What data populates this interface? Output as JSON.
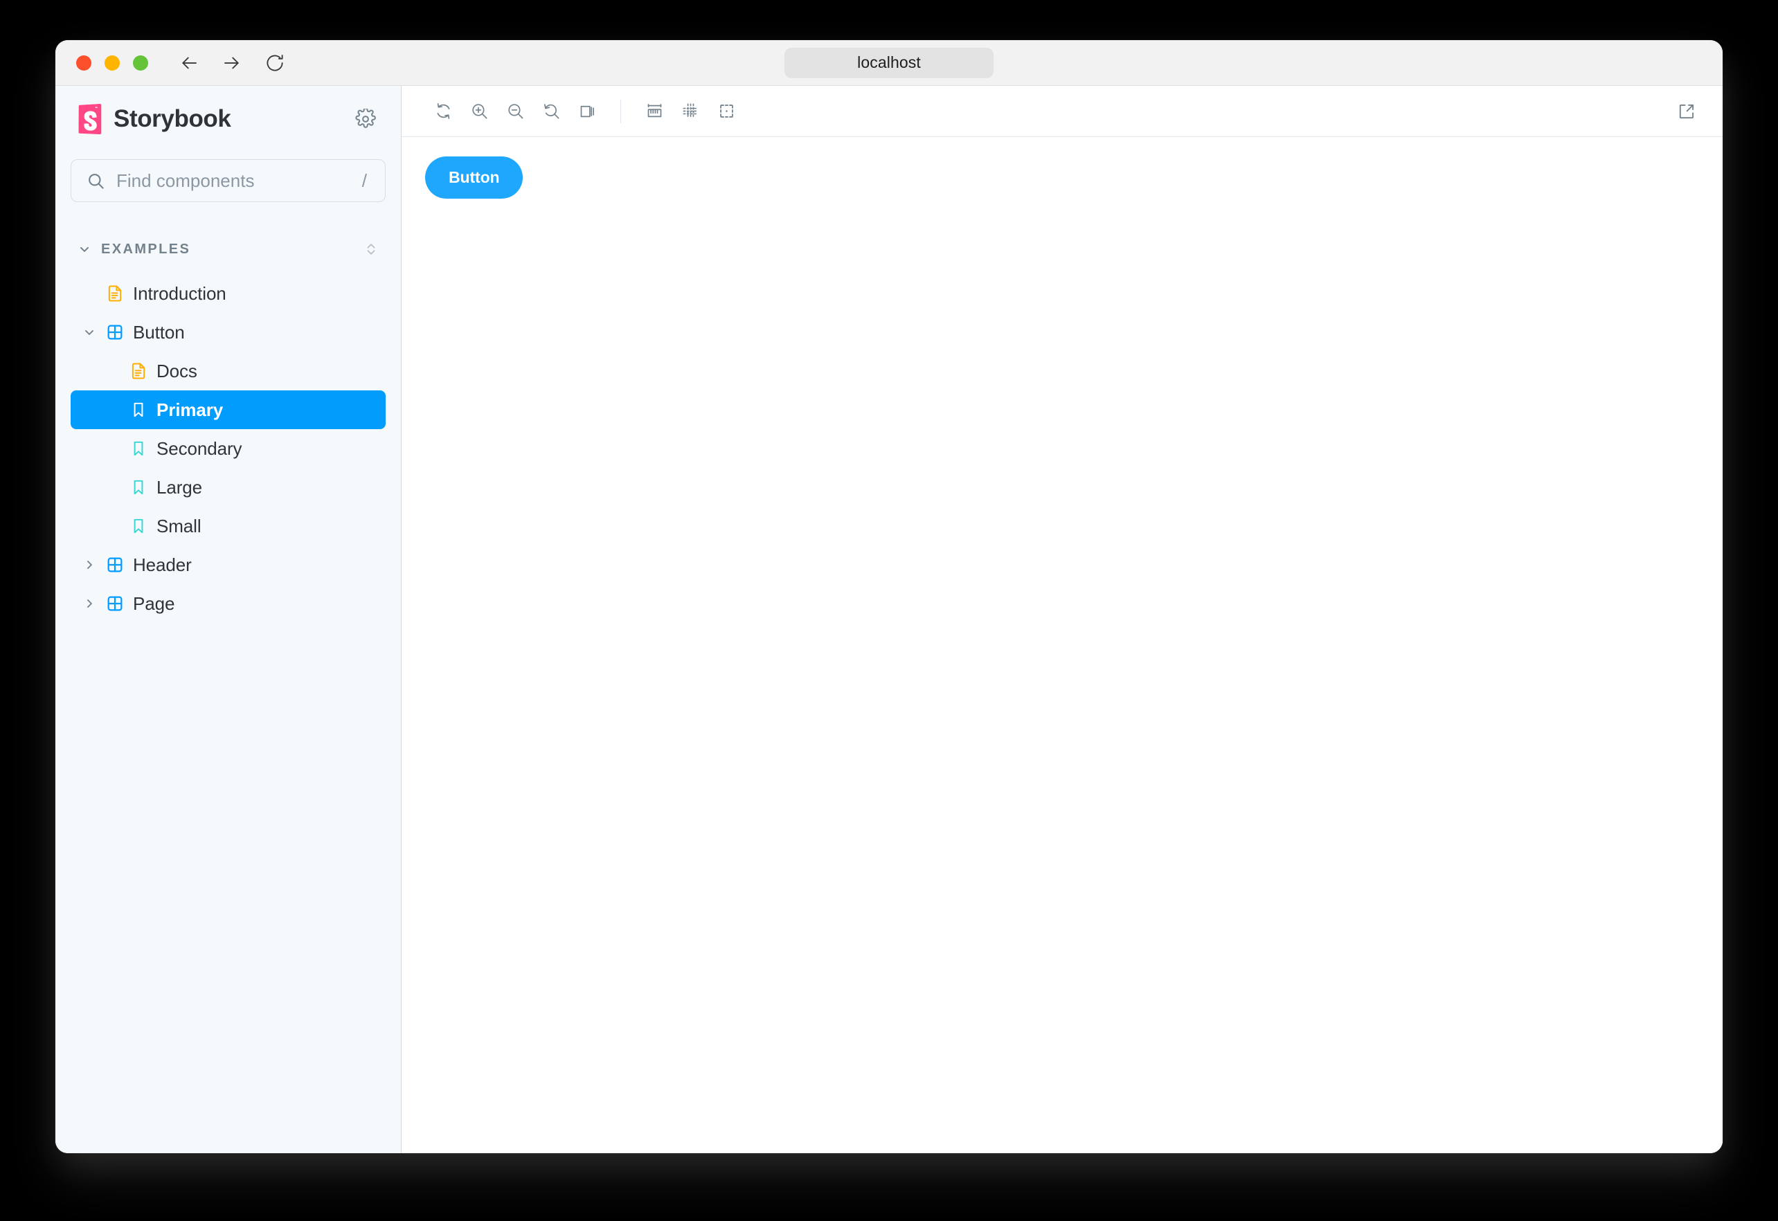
{
  "browser": {
    "url": "localhost",
    "traffic_lights": [
      "close-red",
      "minimize-amber",
      "maximize-green"
    ],
    "nav": {
      "back": "back-arrow",
      "forward": "forward-arrow",
      "reload": "reload"
    },
    "colors": {
      "red": "#fc4f2b",
      "amber": "#ffb400",
      "green": "#64c338",
      "titlebar_bg": "#f3f2f2",
      "url_pill_bg": "#e4e3e3"
    }
  },
  "sidebar": {
    "brand": "Storybook",
    "brand_icon": "storybook-logo-icon",
    "brand_color": "#ff4785",
    "settings_icon": "gear-icon",
    "search": {
      "placeholder": "Find components",
      "value": "",
      "shortcut": "/",
      "icon": "search-icon"
    },
    "group": {
      "label": "EXAMPLES",
      "expanded": true,
      "caret_icon": "chevron-down-icon",
      "sort_icon": "expand-collapse-icon"
    },
    "items": [
      {
        "label": "Introduction",
        "type": "docs",
        "icon": "document-icon",
        "depth": 1,
        "caret": "none",
        "selected": false
      },
      {
        "label": "Button",
        "type": "component",
        "icon": "component-grid-icon",
        "depth": 1,
        "caret": "chevron-down-icon",
        "selected": false
      },
      {
        "label": "Docs",
        "type": "docs",
        "icon": "document-icon",
        "depth": 2,
        "caret": "none",
        "selected": false
      },
      {
        "label": "Primary",
        "type": "story",
        "icon": "bookmark-icon",
        "depth": 2,
        "caret": "none",
        "selected": true
      },
      {
        "label": "Secondary",
        "type": "story",
        "icon": "bookmark-icon",
        "depth": 2,
        "caret": "none",
        "selected": false
      },
      {
        "label": "Large",
        "type": "story",
        "icon": "bookmark-icon",
        "depth": 2,
        "caret": "none",
        "selected": false
      },
      {
        "label": "Small",
        "type": "story",
        "icon": "bookmark-icon",
        "depth": 2,
        "caret": "none",
        "selected": false
      },
      {
        "label": "Header",
        "type": "component",
        "icon": "component-grid-icon",
        "depth": 1,
        "caret": "chevron-right-icon",
        "selected": false
      },
      {
        "label": "Page",
        "type": "component",
        "icon": "component-grid-icon",
        "depth": 1,
        "caret": "chevron-right-icon",
        "selected": false
      }
    ],
    "colors": {
      "bg": "#f6f9fc",
      "selected_bg": "#029cfd",
      "docs_icon": "#ffae00",
      "component_icon": "#029cfd",
      "story_icon": "#37d5d3",
      "text": "#2e3438",
      "muted_text": "#73828c"
    }
  },
  "toolbar": {
    "left_tools": [
      {
        "name": "remount-button",
        "icon": "remount-icon",
        "title": "Remount component"
      },
      {
        "name": "zoom-in-button",
        "icon": "zoom-in-icon",
        "title": "Zoom in"
      },
      {
        "name": "zoom-out-button",
        "icon": "zoom-out-icon",
        "title": "Zoom out"
      },
      {
        "name": "zoom-reset-button",
        "icon": "zoom-reset-icon",
        "title": "Reset zoom"
      },
      {
        "name": "backgrounds-button",
        "icon": "backgrounds-icon",
        "title": "Change background"
      }
    ],
    "right_tools": [
      {
        "name": "measure-button",
        "icon": "ruler-icon",
        "title": "Enable measure"
      },
      {
        "name": "grid-button",
        "icon": "grid-icon",
        "title": "Apply a grid"
      },
      {
        "name": "outline-button",
        "icon": "outline-icon",
        "title": "Apply outlines"
      }
    ],
    "open_new_tab": {
      "name": "open-canvas-in-new-tab-button",
      "icon": "external-link-icon",
      "title": "Open canvas in new tab"
    },
    "icon_color": "#73828c"
  },
  "canvas": {
    "story_button": {
      "label": "Button",
      "bg": "#1ea7fd",
      "color": "#ffffff",
      "shape": "pill"
    }
  }
}
